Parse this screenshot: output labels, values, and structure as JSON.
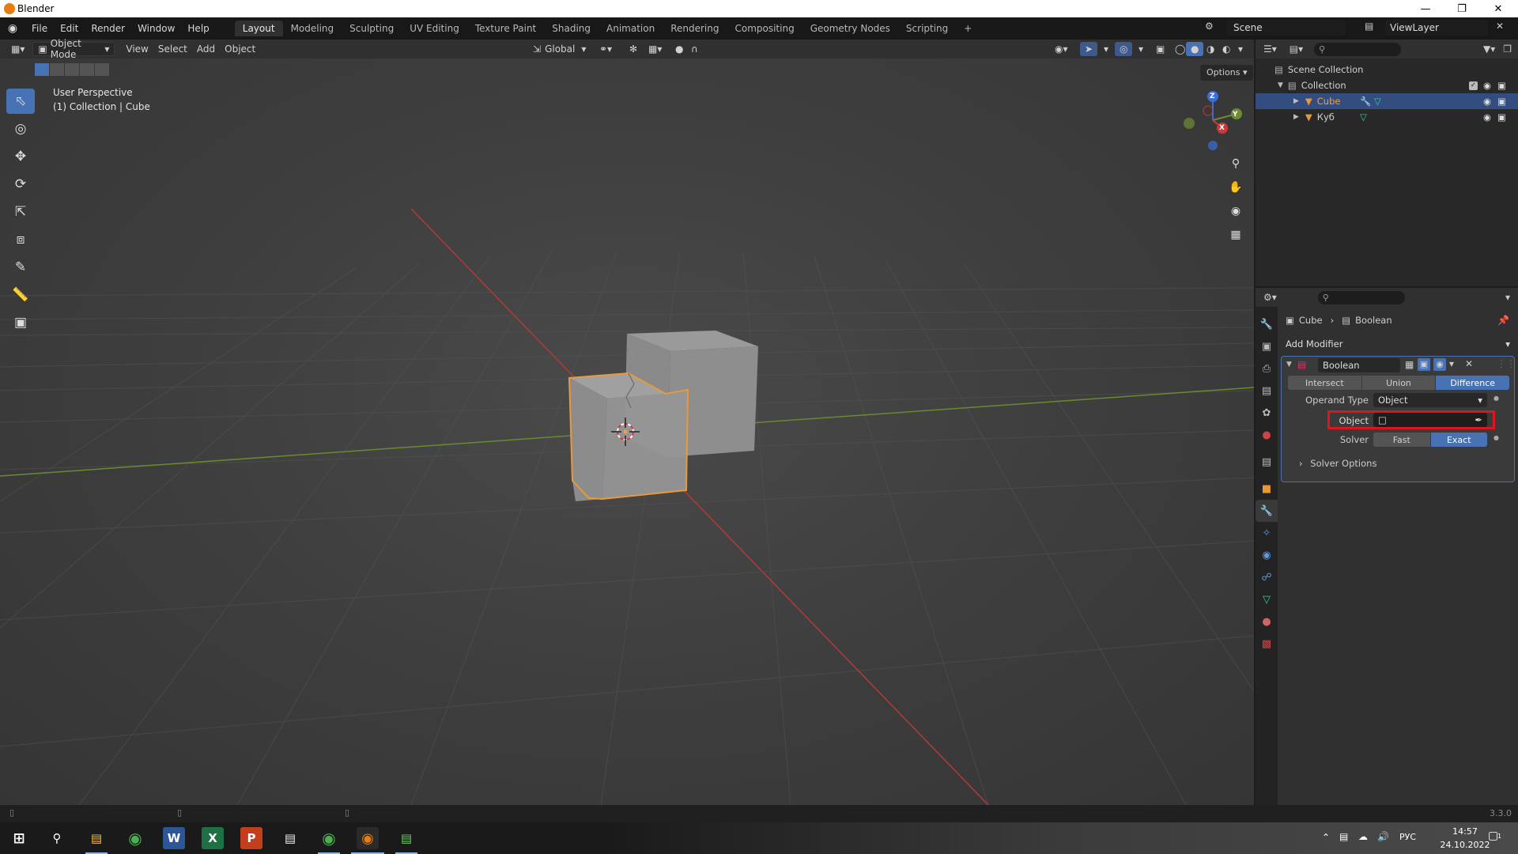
{
  "window": {
    "title": "Blender"
  },
  "menu": [
    "File",
    "Edit",
    "Render",
    "Window",
    "Help"
  ],
  "workspaces": {
    "active": "Layout",
    "tabs": [
      "Layout",
      "Modeling",
      "Sculpting",
      "UV Editing",
      "Texture Paint",
      "Shading",
      "Animation",
      "Rendering",
      "Compositing",
      "Geometry Nodes",
      "Scripting"
    ],
    "add": "+"
  },
  "scene": {
    "name": "Scene",
    "view_layer": "ViewLayer"
  },
  "viewport_header": {
    "mode": "Object Mode",
    "menus": [
      "View",
      "Select",
      "Add",
      "Object"
    ],
    "orientation": "Global",
    "options": "Options"
  },
  "viewport": {
    "perspective": "User Perspective",
    "collection_info": "(1) Collection | Cube",
    "gizmo_axes": {
      "x": "X",
      "y": "Y",
      "z": "Z"
    }
  },
  "outliner": {
    "root": "Scene Collection",
    "collection": "Collection",
    "items": [
      {
        "name": "Cube",
        "selected": true
      },
      {
        "name": "Куб",
        "selected": false
      }
    ]
  },
  "properties": {
    "breadcrumb": {
      "object": "Cube",
      "modifier": "Boolean"
    },
    "add_modifier": "Add Modifier",
    "modifier": {
      "name": "Boolean",
      "operations": [
        "Intersect",
        "Union",
        "Difference"
      ],
      "active_operation": "Difference",
      "operand_type_label": "Operand Type",
      "operand_type_value": "Object",
      "object_label": "Object",
      "object_value": "",
      "solver_label": "Solver",
      "solvers": [
        "Fast",
        "Exact"
      ],
      "active_solver": "Exact",
      "solver_options": "Solver Options"
    }
  },
  "status": {
    "version": "3.3.0"
  },
  "taskbar": {
    "lang": "РУС",
    "time": "14:57",
    "date": "24.10.2022",
    "notification_count": "1"
  },
  "colors": {
    "accent": "#4772b3",
    "selection_outline": "#e89a3a",
    "highlight_box": "#e0141e",
    "x_axis": "#c83c3c",
    "y_axis": "#6e8c32",
    "z_axis": "#3a6fd8"
  }
}
